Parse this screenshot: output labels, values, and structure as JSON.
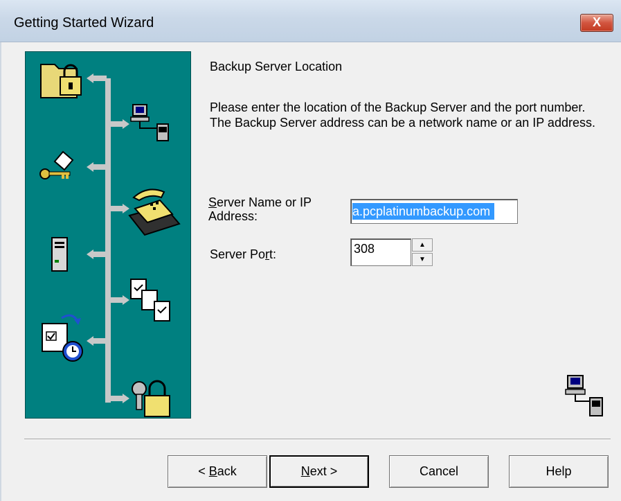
{
  "window": {
    "title": "Getting Started Wizard",
    "close_label": "X"
  },
  "page": {
    "heading": "Backup Server Location",
    "description": "Please enter the location of the Backup Server and the port number.  The Backup Server address can be a network name or an IP address."
  },
  "form": {
    "server_label_mnemonic": "S",
    "server_label_rest": "erver Name or IP Address:",
    "server_value": "a.pcplatinumbackup.com",
    "port_label_pre": "Server Po",
    "port_label_mnemonic": "r",
    "port_label_post": "t:",
    "port_value": "308"
  },
  "buttons": {
    "back_prefix": "< ",
    "back_mnemonic": "B",
    "back_rest": "ack",
    "next_mnemonic": "N",
    "next_rest": "ext >",
    "cancel": "Cancel",
    "help": "Help"
  },
  "colors": {
    "banner": "#008080",
    "selection": "#3399ff",
    "close_button": "#c94a33"
  },
  "icons": {
    "banner_steps": [
      "folder-lock-icon",
      "network-computers-icon",
      "key-icon",
      "phone-icon",
      "server-icon",
      "documents-icon",
      "schedule-icon",
      "keys-lock-icon"
    ],
    "corner": "network-computers-icon"
  }
}
